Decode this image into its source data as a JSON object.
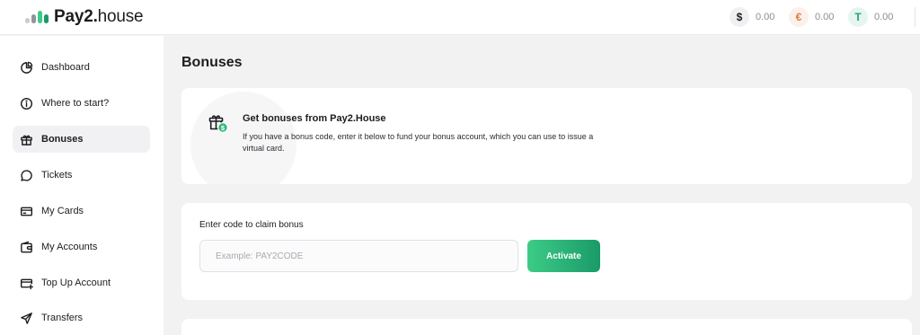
{
  "app": {
    "logo_bold": "Pay2.",
    "logo_light": "house"
  },
  "balances": [
    {
      "currency": "usd",
      "symbol": "$",
      "value": "0.00",
      "icon": "dollar-icon",
      "color": "#1c1d21",
      "bg": "#f0f0f2"
    },
    {
      "currency": "eur",
      "symbol": "€",
      "value": "0.00",
      "icon": "euro-icon",
      "color": "#e07a3f",
      "bg": "#fbf0ea"
    },
    {
      "currency": "usdt",
      "symbol": "T",
      "value": "0.00",
      "icon": "tether-icon",
      "color": "#26a17b",
      "bg": "#e6f5ef"
    }
  ],
  "sidebar": {
    "items": [
      {
        "label": "Dashboard",
        "icon": "pie-chart-icon"
      },
      {
        "label": "Where to start?",
        "icon": "info-icon"
      },
      {
        "label": "Bonuses",
        "icon": "gift-icon",
        "active": true
      },
      {
        "label": "Tickets",
        "icon": "chat-icon"
      },
      {
        "label": "My Cards",
        "icon": "card-icon"
      },
      {
        "label": "My Accounts",
        "icon": "wallet-icon"
      },
      {
        "label": "Top Up Account",
        "icon": "top-up-icon"
      },
      {
        "label": "Transfers",
        "icon": "send-icon"
      }
    ]
  },
  "main": {
    "title": "Bonuses",
    "intro": {
      "title": "Get bonuses from Pay2.House",
      "text": "If you have a bonus code, enter it below to fund your bonus account, which you can use to issue a virtual card."
    },
    "claim": {
      "label": "Enter code to claim bonus",
      "input_value": "",
      "placeholder": "Example: PAY2CODE",
      "button_label": "Activate"
    }
  },
  "colors": {
    "accent_start": "#3ccc87",
    "accent_end": "#1a9a68",
    "page_bg": "#f2f2f3"
  }
}
